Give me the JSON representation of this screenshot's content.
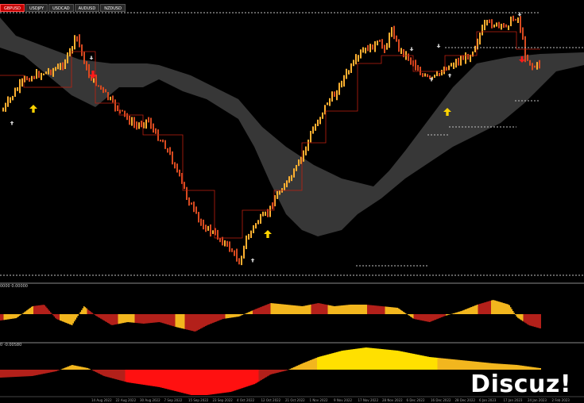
{
  "tabs": [
    {
      "label": "GBPUSD",
      "active": true
    },
    {
      "label": "USDJPY",
      "active": false
    },
    {
      "label": "USDCAD",
      "active": false
    },
    {
      "label": "AUDUSD",
      "active": false
    },
    {
      "label": "NZDUSD",
      "active": false
    }
  ],
  "indicators": {
    "first_label": "0000 0.00000",
    "second_label": "0 -0.00580"
  },
  "time_axis": {
    "ticks": [
      "14 Aug 2022",
      "22 Aug 2022",
      "30 Aug 2022",
      "7 Sep 2022",
      "15 Sep 2022",
      "23 Sep 2022",
      "4 Oct 2022",
      "12 Oct 2022",
      "21 Oct 2022",
      "1 Nov 2022",
      "9 Nov 2022",
      "17 Nov 2022",
      "28 Nov 2022",
      "6 Dec 2022",
      "16 Dec 2022",
      "28 Dec 2022",
      "6 Jan 2023",
      "17 Jan 2023",
      "24 Jan 2023",
      "2 Feb 2023"
    ]
  },
  "watermark": "Discuz!",
  "colors": {
    "background": "#000000",
    "bull_candle": "#ffb030",
    "bear_candle": "#d84a20",
    "cloud": "#3a3a3a",
    "up_arrow": "#ffd400",
    "down_arrow": "#ff1a1a",
    "hist_yellow": "#f2b61e",
    "hist_red": "#b3201a",
    "hist_bright_red": "#ff1010",
    "hist_bright_yellow": "#ffe000",
    "separator": "#8a8a8a"
  },
  "icons": {
    "up_arrow": "up-arrow-icon",
    "down_arrow": "down-arrow-icon",
    "small_arrow": "small-arrow-icon"
  }
}
